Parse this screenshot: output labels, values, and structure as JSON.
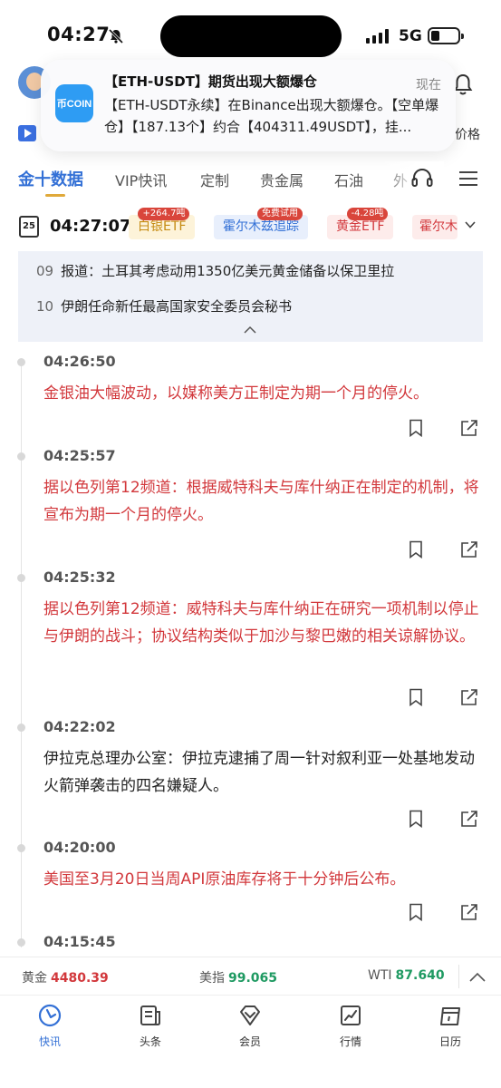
{
  "status_bar": {
    "time": "04:27",
    "network": "5G"
  },
  "notification": {
    "app_icon_text": "币COIN",
    "title": "【ETH-USDT】期货出现大额爆仓",
    "time": "现在",
    "body": "【ETH-USDT永续】在Binance出现大额爆仓。【空单爆仓】【187.13个】约合【404311.49USDT】，挂..."
  },
  "header": {
    "price_link": "价格"
  },
  "tabs": [
    {
      "label": "金十数据",
      "active": true
    },
    {
      "label": "VIP快讯"
    },
    {
      "label": "定制"
    },
    {
      "label": "贵金属"
    },
    {
      "label": "石油"
    },
    {
      "label": "外"
    }
  ],
  "ticker": {
    "calendar_day": "25",
    "clock": "04:27:07",
    "chips": [
      {
        "label": "白银ETF",
        "badge": "+264.7吨"
      },
      {
        "label": "霍尔木兹追踪",
        "badge": "免费试用"
      },
      {
        "label": "黄金ETF",
        "badge": "-4.28吨"
      },
      {
        "label": "霍尔木"
      }
    ]
  },
  "headlines": [
    {
      "num": "09",
      "text": "报道：土耳其考虑动用1350亿美元黄金储备以保卫里拉"
    },
    {
      "num": "10",
      "text": "伊朗任命新任最高国家安全委员会秘书"
    }
  ],
  "feed": [
    {
      "time": "04:26:50",
      "text": "金银油大幅波动，以媒称美方正制定为期一个月的停火。",
      "color": "red"
    },
    {
      "time": "04:25:57",
      "text": "据以色列第12频道：根据威特科夫与库什纳正在制定的机制，将宣布为期一个月的停火。",
      "color": "red"
    },
    {
      "time": "04:25:32",
      "text": "据以色列第12频道：威特科夫与库什纳正在研究一项机制以停止与伊朗的战斗；协议结构类似于加沙与黎巴嫩的相关谅解协议。",
      "color": "red"
    },
    {
      "time": "04:22:02",
      "text": "伊拉克总理办公室：伊拉克逮捕了周一针对叙利亚一处基地发动火箭弹袭击的四名嫌疑人。",
      "color": "black"
    },
    {
      "time": "04:20:00",
      "text": "美国至3月20日当周API原油库存将于十分钟后公布。",
      "color": "red"
    },
    {
      "time": "04:15:45",
      "text": "",
      "color": "black"
    }
  ],
  "market": [
    {
      "name": "黄金",
      "value": "4480.39",
      "trend": "red"
    },
    {
      "name": "美指",
      "value": "99.065",
      "trend": "green"
    },
    {
      "name": "WTI",
      "value": "87.640",
      "trend": "green"
    }
  ],
  "bottom_nav": [
    {
      "label": "快讯",
      "icon": "flash-news-icon",
      "active": true
    },
    {
      "label": "头条",
      "icon": "headline-icon"
    },
    {
      "label": "会员",
      "icon": "vip-diamond-icon"
    },
    {
      "label": "行情",
      "icon": "market-chart-icon"
    },
    {
      "label": "日历",
      "icon": "calendar-icon"
    }
  ],
  "colors": {
    "accent_blue": "#3370d6",
    "news_red": "#d2383c",
    "up_green": "#1f9a62",
    "tab_underline": "#e0a93a"
  }
}
